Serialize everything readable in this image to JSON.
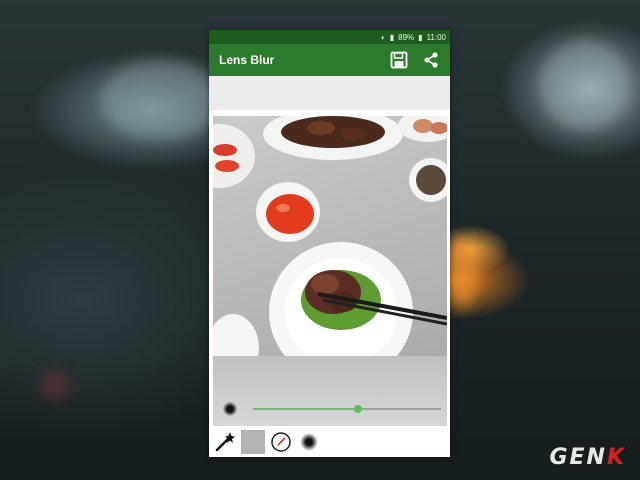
{
  "status_bar": {
    "battery": "89%",
    "time": "11:00"
  },
  "app_bar": {
    "title": "Lens Blur",
    "actions": [
      "save-icon",
      "share-icon"
    ]
  },
  "blur_control": {
    "slider_value": 0.56,
    "accent_color": "#5fbf5f"
  },
  "toolbar": {
    "tools": [
      "magic-wand-icon",
      "gray-square-icon",
      "focus-point-icon",
      "blur-brush-icon"
    ]
  },
  "watermark": {
    "text_a": "GEN",
    "text_b": "K"
  },
  "colors": {
    "status_bar": "#1e5b1e",
    "app_bar": "#2c7a2c"
  }
}
